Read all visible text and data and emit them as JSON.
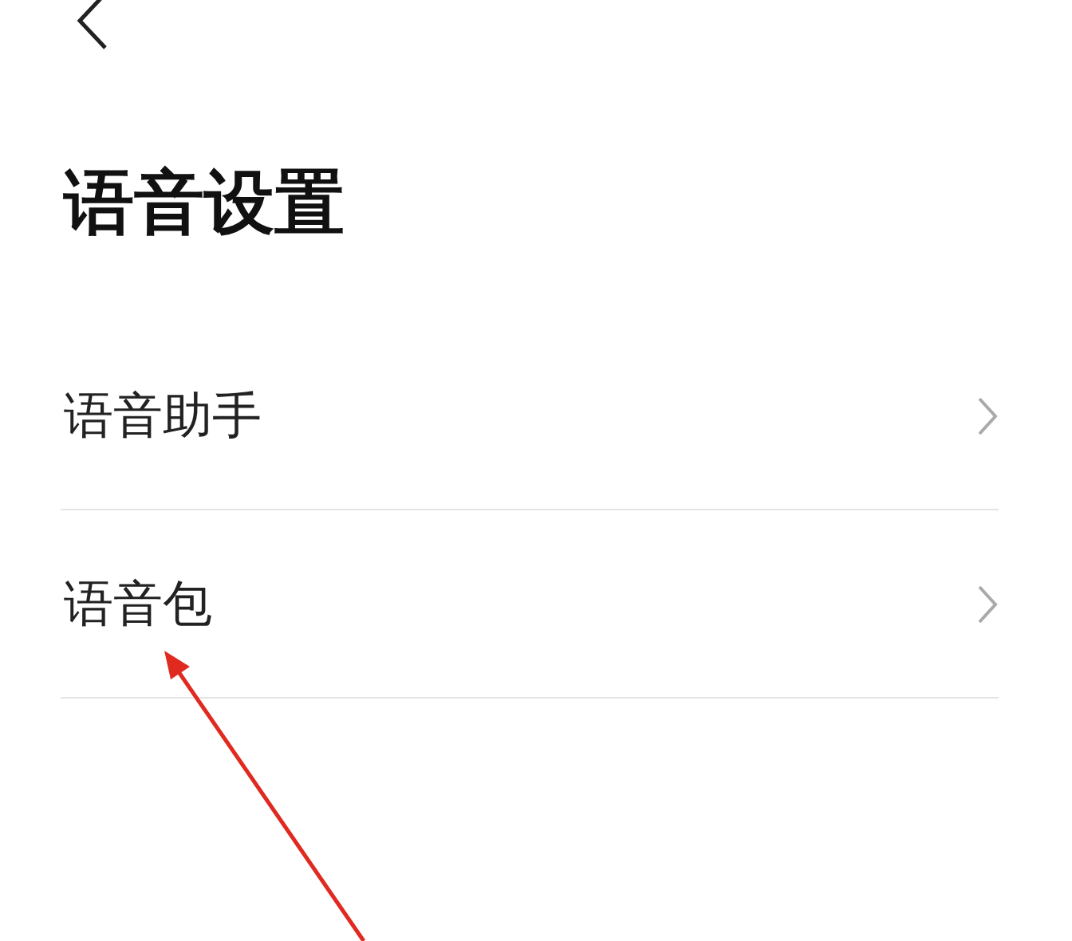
{
  "screen": {
    "title": "语音设置"
  },
  "items": [
    {
      "label": "语音助手"
    },
    {
      "label": "语音包"
    }
  ]
}
